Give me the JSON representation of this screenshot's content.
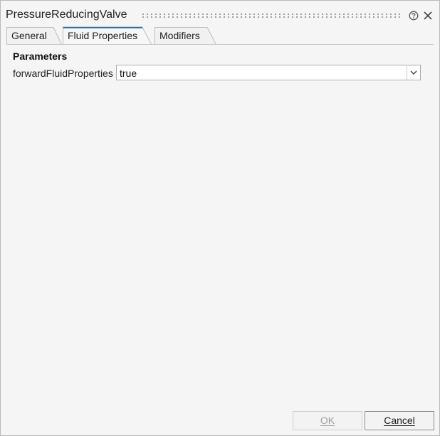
{
  "window": {
    "title": "PressureReducingValve"
  },
  "tabs": [
    {
      "label": "General",
      "active": false
    },
    {
      "label": "Fluid Properties",
      "active": true
    },
    {
      "label": "Modifiers",
      "active": false
    }
  ],
  "panel": {
    "section_title": "Parameters",
    "parameters": [
      {
        "label": "forwardFluidProperties",
        "value": "true"
      }
    ]
  },
  "buttons": {
    "ok_label": "OK",
    "cancel_label": "Cancel"
  },
  "icons": {
    "help": "help-circle-icon",
    "close": "close-icon",
    "dropdown": "chevron-down-icon"
  },
  "colors": {
    "active_tab_accent": "#1f6fb0",
    "background": "#f5f5f5"
  }
}
